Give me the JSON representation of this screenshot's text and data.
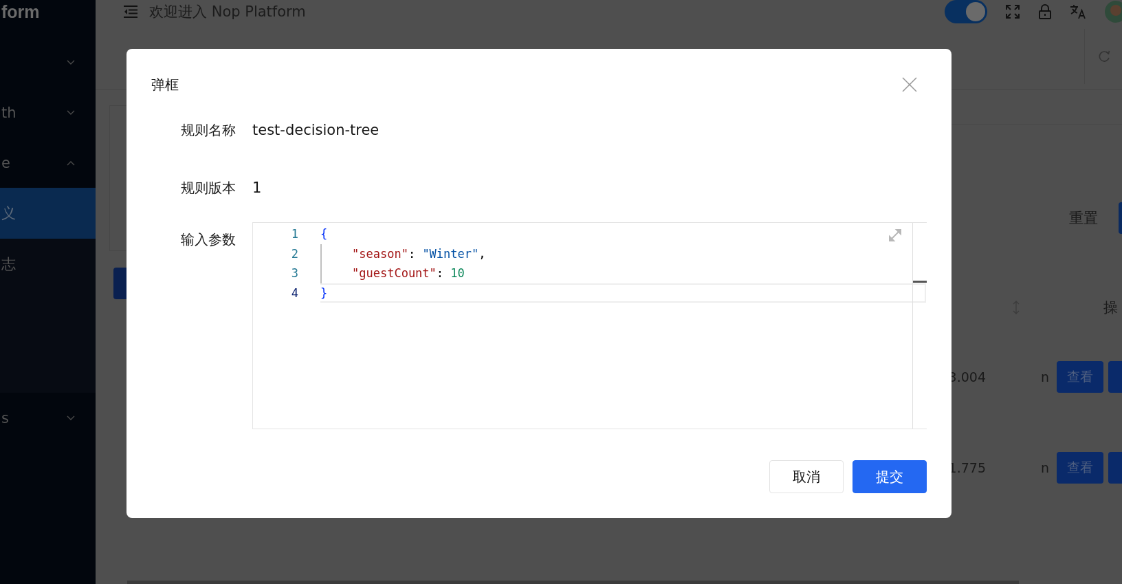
{
  "sidebar": {
    "logo": "form",
    "items": [
      {
        "kind": "group",
        "expanded": false
      },
      {
        "kind": "group",
        "label": "th",
        "expanded": false
      },
      {
        "kind": "group",
        "label": "e",
        "expanded": true,
        "children": [
          {
            "label": "义",
            "selected": true
          },
          {
            "label": "志",
            "selected": false
          }
        ]
      },
      {
        "kind": "group",
        "label": "s",
        "expanded": false
      }
    ]
  },
  "header": {
    "title": "欢迎进入 Nop Platform",
    "theme_toggle": {
      "on": true
    }
  },
  "background": {
    "reset_button": "重置",
    "column_header": "操",
    "rows": [
      {
        "value": "3.004",
        "code": "n",
        "action": "查看"
      },
      {
        "value": "1.775",
        "code": "n",
        "action": "查看"
      }
    ]
  },
  "dialog": {
    "title": "弹框",
    "fields": [
      {
        "kind": "text",
        "label": "规则名称",
        "value": "test-decision-tree"
      },
      {
        "kind": "text",
        "label": "规则版本",
        "value": "1"
      },
      {
        "kind": "code",
        "label": "输入参数",
        "lines": [
          {
            "number": "1",
            "current": false,
            "tokens": [
              {
                "kind": "brace",
                "text": "{"
              }
            ]
          },
          {
            "number": "2",
            "current": false,
            "tokens": [
              {
                "kind": "key",
                "text": "\"season\""
              },
              {
                "kind": "punct",
                "text": ": "
              },
              {
                "kind": "string",
                "text": "\"Winter\""
              },
              {
                "kind": "punct",
                "text": ","
              }
            ]
          },
          {
            "number": "3",
            "current": false,
            "tokens": [
              {
                "kind": "key",
                "text": "\"guestCount\""
              },
              {
                "kind": "punct",
                "text": ": "
              },
              {
                "kind": "number",
                "text": "10"
              }
            ]
          },
          {
            "number": "4",
            "current": true,
            "tokens": [
              {
                "kind": "brace",
                "text": "}"
              }
            ]
          }
        ]
      }
    ],
    "buttons": [
      {
        "kind": "default",
        "label": "取消"
      },
      {
        "kind": "primary",
        "label": "提交"
      }
    ]
  }
}
